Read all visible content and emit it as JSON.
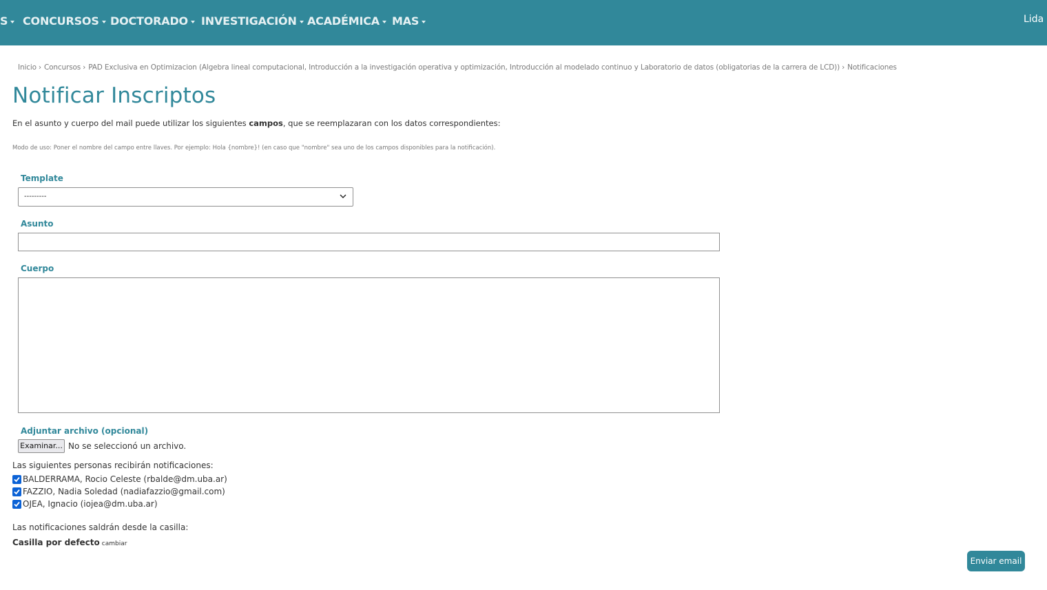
{
  "nav": {
    "items": [
      "S",
      "CONCURSOS",
      "DOCTORADO",
      "INVESTIGACIÓN",
      "ACADÉMICA",
      "MAS"
    ],
    "user_name": "Lida S"
  },
  "breadcrumb": {
    "items": [
      "Inicio",
      "Concursos",
      "PAD Exclusiva en Optimizacion (Algebra lineal computacional, Introducción a la investigación operativa y optimización, Introducción al modelado continuo y Laboratorio de datos (obligatorias de la carrera de LCD))",
      "Notificaciones"
    ]
  },
  "page": {
    "title": "Notificar Inscriptos",
    "intro_before": "En el asunto y cuerpo del mail puede utilizar los siguientes ",
    "intro_bold": "campos",
    "intro_after": ", que se reemplazaran con los datos correspondientes:",
    "usage_note": "Modo de uso: Poner el nombre del campo entre llaves. Por ejemplo: Hola {nombre}! (en caso que \"nombre\" sea uno de los campos disponibles para la notificación)."
  },
  "form": {
    "template_label": "Template",
    "template_value": "---------",
    "subject_label": "Asunto",
    "subject_value": "",
    "body_label": "Cuerpo",
    "body_value": "",
    "attachment_label": "Adjuntar archivo (opcional)",
    "browse_button": "Examinar...",
    "no_file_text": "No se seleccionó un archivo."
  },
  "recipients": {
    "label": "Las siguientes personas recibirán notificaciones:",
    "items": [
      {
        "text": "BALDERRAMA, Rocio Celeste (rbalde@dm.uba.ar)",
        "checked": true
      },
      {
        "text": "FAZZIO, Nadia Soledad (nadiafazzio@gmail.com)",
        "checked": true
      },
      {
        "text": "OJEA, Ignacio (iojea@dm.uba.ar)",
        "checked": true
      }
    ]
  },
  "sender": {
    "label": "Las notificaciones saldrán desde la casilla:",
    "value": "Casilla por defecto",
    "change_link": "cambiar"
  },
  "actions": {
    "send_button": "Enviar email"
  },
  "colors": {
    "brand": "#31889a",
    "checkbox": "#0b62d6"
  }
}
